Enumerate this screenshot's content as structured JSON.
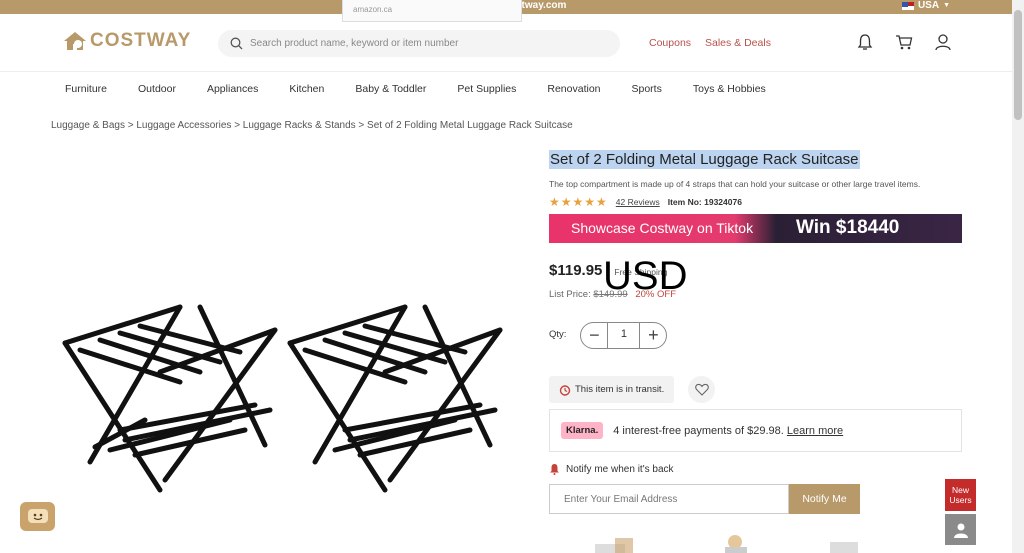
{
  "top_banner": {
    "welcome": "Welcome to costway.com",
    "region": "USA",
    "amazon_tip": "amazon.ca"
  },
  "header": {
    "logo_text": "COSTWAY",
    "search_placeholder": "Search product name, keyword or item number",
    "coupons": "Coupons",
    "sales_deals": "Sales & Deals",
    "icons": [
      "bell-icon",
      "cart-icon",
      "user-icon"
    ]
  },
  "nav": {
    "items": [
      "Furniture",
      "Outdoor",
      "Appliances",
      "Kitchen",
      "Baby & Toddler",
      "Pet Supplies",
      "Renovation",
      "Sports",
      "Toys & Hobbies"
    ]
  },
  "breadcrumb": "Luggage & Bags > Luggage Accessories > Luggage Racks & Stands >  Set of 2 Folding Metal Luggage Rack Suitcase",
  "product": {
    "title": "Set of 2 Folding Metal Luggage Rack Suitcase",
    "description": "The top compartment is made up of 4 straps that can hold your suitcase or other large travel items.",
    "stars": "★★★★★",
    "reviews": "42 Reviews",
    "item_no_label": "Item No:",
    "item_no": "19324076",
    "price": "$119.95",
    "shipping": "Free Shipping",
    "currency_overlay": "USD",
    "list_price_label": "List Price:",
    "list_price": "$149.99",
    "discount": "20% OFF",
    "qty_label": "Qty:",
    "qty_value": "1",
    "minus": "−",
    "plus": "+",
    "transit": "This item is in transit.",
    "klarna_badge": "Klarna.",
    "klarna_text": "4 interest-free payments of $29.98.",
    "klarna_link": "Learn more",
    "notify_label": "Notify me when it's back",
    "email_placeholder": "Enter Your Email Address",
    "notify_button": "Notify Me"
  },
  "promo_banner": {
    "left": "Showcase Costway on Tiktok",
    "right": "Win $18440"
  },
  "widgets": {
    "new_users": "New Users"
  },
  "colors": {
    "brand": "#b8996a",
    "sale_red": "#c4433b",
    "title_highlight": "#bcd4f0"
  }
}
